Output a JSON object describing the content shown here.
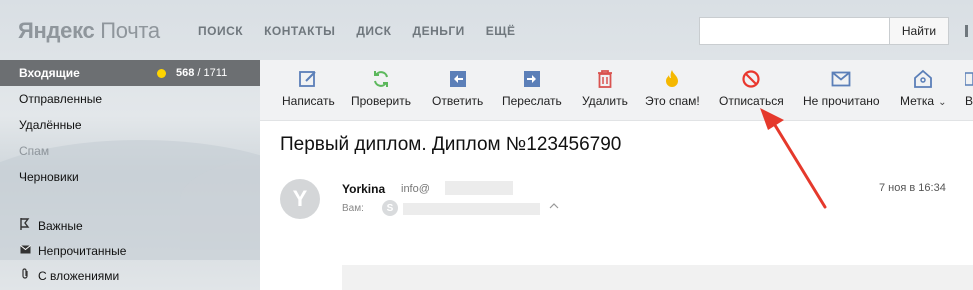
{
  "header": {
    "logo": {
      "brand": "Яндекс",
      "product": "Почта"
    },
    "nav": [
      "ПОИСК",
      "КОНТАКТЫ",
      "ДИСК",
      "ДЕНЬГИ",
      "ЕЩЁ"
    ],
    "search": {
      "value": "",
      "button_label": "Найти"
    }
  },
  "sidebar": {
    "active_folder": {
      "label": "Входящие",
      "unread": "568",
      "total": "/ 1711",
      "dot_color": "#ffd500"
    },
    "folders": [
      "Отправленные",
      "Удалённые",
      "Спам",
      "Черновики"
    ],
    "labels": [
      {
        "label": "Важные",
        "icon": "important-icon"
      },
      {
        "label": "Непрочитанные",
        "icon": "unread-icon"
      },
      {
        "label": "С вложениями",
        "icon": "attachment-icon"
      }
    ]
  },
  "toolbar": {
    "compose": "Написать",
    "check": "Проверить",
    "reply": "Ответить",
    "forward": "Переслать",
    "delete": "Удалить",
    "spam": "Это спам!",
    "unsubscribe": "Отписаться",
    "mark_unread": "Не прочитано",
    "label": "Метка",
    "more": "В"
  },
  "message": {
    "subject": "Первый диплом. Диплом №123456790",
    "sender_initial": "Y",
    "sender_name": "Yorkina",
    "sender_email": "info@",
    "date": "7 ноя в 16:34",
    "to_label": "Вам:",
    "to_initial": "S"
  },
  "colors": {
    "accent_arrow": "#e5392c",
    "sidebar_active": "#6c6f72",
    "unsubscribe_icon": "#e9382e",
    "check_icon": "#5cb85c",
    "spam_icon": "#f5b800"
  }
}
